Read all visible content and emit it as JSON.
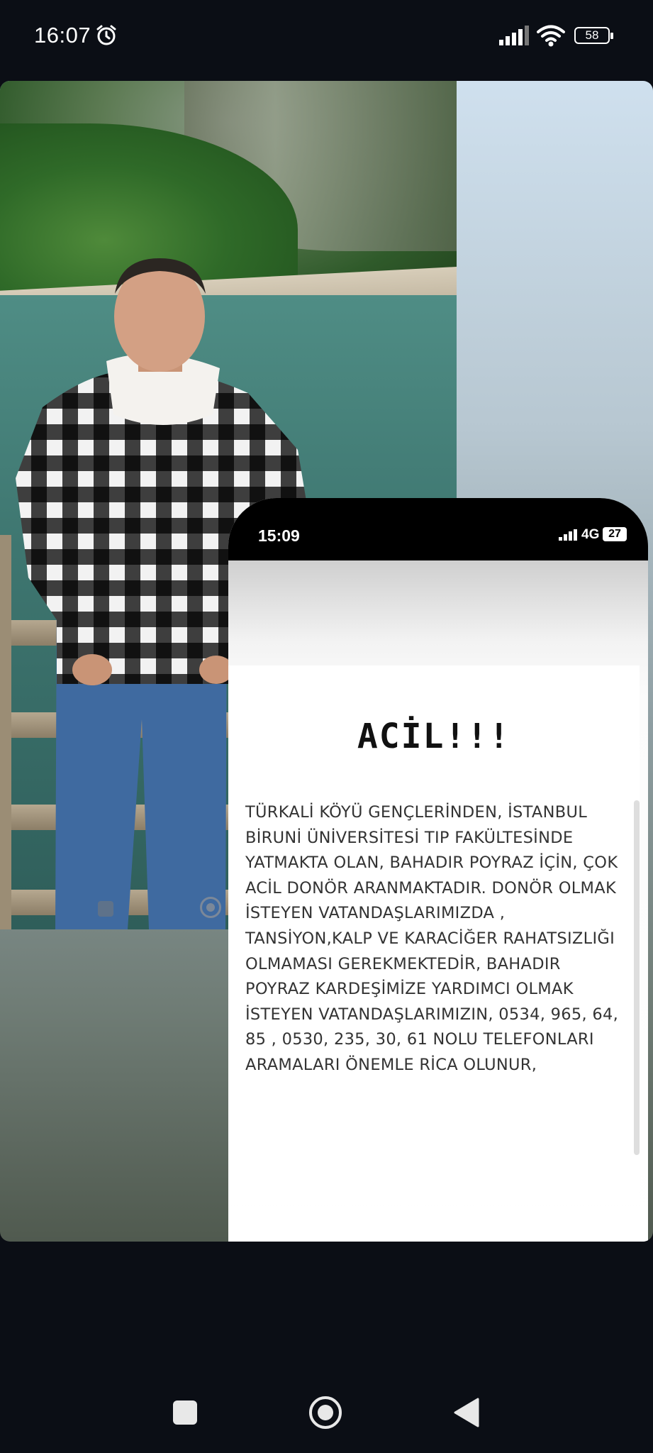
{
  "status_bar": {
    "time": "16:07",
    "alarm_icon": "alarm-clock-icon",
    "signal_icon": "signal-bars-icon",
    "wifi_icon": "wifi-icon",
    "battery_level": "58"
  },
  "nav_bar": {
    "recents_icon": "square-recents-icon",
    "home_icon": "circle-home-icon",
    "back_icon": "triangle-back-icon"
  },
  "inset_screenshot": {
    "time": "15:09",
    "network": "4G",
    "battery_level": "27",
    "title": "ACİL!!!",
    "message": "TÜRKALİ KÖYÜ GENÇLERİNDEN, İSTANBUL BİRUNİ ÜNİVERSİTESİ TIP FAKÜLTESİNDE YATMAKTA OLAN, BAHADIR POYRAZ İÇİN, ÇOK ACİL DONÖR ARANMAKTADIR. DONÖR OLMAK İSTEYEN VATANDAŞLARIMIZDA , TANSİYON,KALP VE KARACİĞER RAHATSIZLIĞI OLMAMASI GEREKMEKTEDİR, BAHADIR POYRAZ KARDEŞİMİZE YARDIMCI OLMAK İSTEYEN VATANDAŞLARIMIZIN, 0534, 965, 64, 85 , 0530, 235, 30, 61 NOLU TELEFONLARI ARAMALARI ÖNEMLE RİCA OLUNUR,"
  },
  "colors": {
    "background": "#0b0e15",
    "inset_status": "#000000",
    "nav_icons": "#e8e8e8"
  }
}
